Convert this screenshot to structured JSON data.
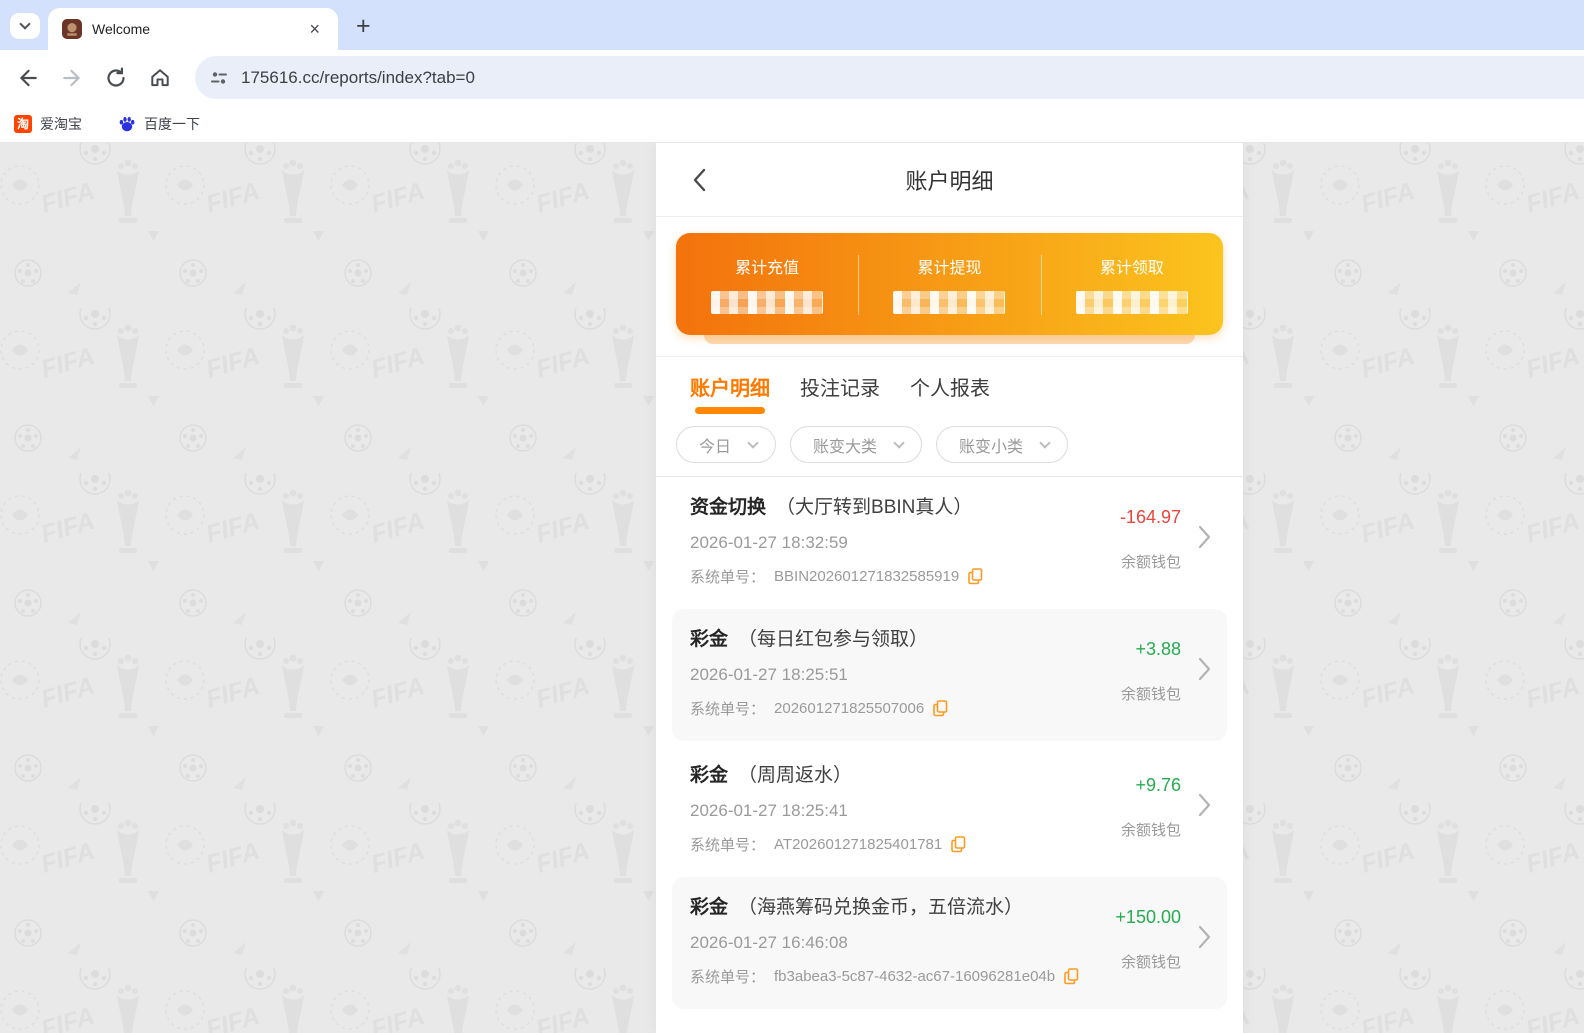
{
  "browser": {
    "tab_title": "Welcome",
    "close_icon": "×",
    "new_tab_icon": "+",
    "url": "175616.cc/reports/index?tab=0",
    "bookmarks": [
      {
        "label": "爱淘宝",
        "icon_glyph": "淘"
      },
      {
        "label": "百度一下"
      }
    ]
  },
  "page": {
    "header": {
      "title": "账户明细"
    },
    "summary_card": {
      "items": [
        {
          "label": "累计充值"
        },
        {
          "label": "累计提现"
        },
        {
          "label": "累计领取"
        }
      ]
    },
    "tabs": [
      {
        "label": "账户明细",
        "active": true
      },
      {
        "label": "投注记录",
        "active": false
      },
      {
        "label": "个人报表",
        "active": false
      }
    ],
    "filters": [
      {
        "label": "今日"
      },
      {
        "label": "账变大类"
      },
      {
        "label": "账变小类"
      }
    ],
    "order_prefix": "系统单号：",
    "transactions": [
      {
        "type": "资金切换",
        "desc": "（大厅转到BBIN真人）",
        "datetime": "2026-01-27 18:32:59",
        "order_no": "BBIN202601271832585919",
        "amount": "-164.97",
        "wallet": "余额钱包"
      },
      {
        "type": "彩金",
        "desc": "（每日红包参与领取）",
        "datetime": "2026-01-27 18:25:51",
        "order_no": "202601271825507006",
        "amount": "+3.88",
        "wallet": "余额钱包"
      },
      {
        "type": "彩金",
        "desc": "（周周返水）",
        "datetime": "2026-01-27 18:25:41",
        "order_no": "AT202601271825401781",
        "amount": "+9.76",
        "wallet": "余额钱包"
      },
      {
        "type": "彩金",
        "desc": "（海燕筹码兑换金币，五倍流水）",
        "datetime": "2026-01-27 16:46:08",
        "order_no": "fb3abea3-5c87-4632-ac67-16096281e04b",
        "amount": "+150.00",
        "wallet": "余额钱包"
      }
    ],
    "colors": {
      "accent": "#ff7a00",
      "card_gradient_start": "#f3720c",
      "card_gradient_end": "#fbc41e",
      "negative": "#e8453c",
      "positive": "#27ab51"
    }
  }
}
